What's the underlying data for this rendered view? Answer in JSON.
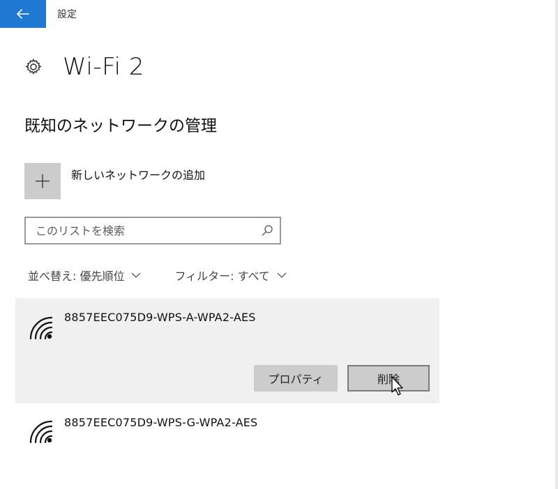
{
  "window": {
    "title": "設定"
  },
  "header": {
    "title": "Wi-Fi 2"
  },
  "section": {
    "title": "既知のネットワークの管理"
  },
  "add_network": {
    "label": "新しいネットワークの追加"
  },
  "search": {
    "placeholder": "このリストを検索"
  },
  "filters": {
    "sort": "並べ替え: 優先順位",
    "filter": "フィルター: すべて"
  },
  "networks": [
    {
      "name": "8857EEC075D9-WPS-A-WPA2-AES",
      "selected": true,
      "properties_label": "プロパティ",
      "delete_label": "削除"
    },
    {
      "name": "8857EEC075D9-WPS-G-WPA2-AES",
      "selected": false
    }
  ],
  "icons": {
    "back": "back-arrow-icon",
    "settings": "gear-icon",
    "add": "plus-icon",
    "search": "search-icon",
    "chevron": "chevron-down-icon",
    "wifi": "wifi-icon",
    "cursor": "mouse-cursor-icon"
  },
  "colors": {
    "accent": "#1f78d1",
    "selected_bg": "#f0f0f0",
    "button_bg": "#cccccc"
  }
}
